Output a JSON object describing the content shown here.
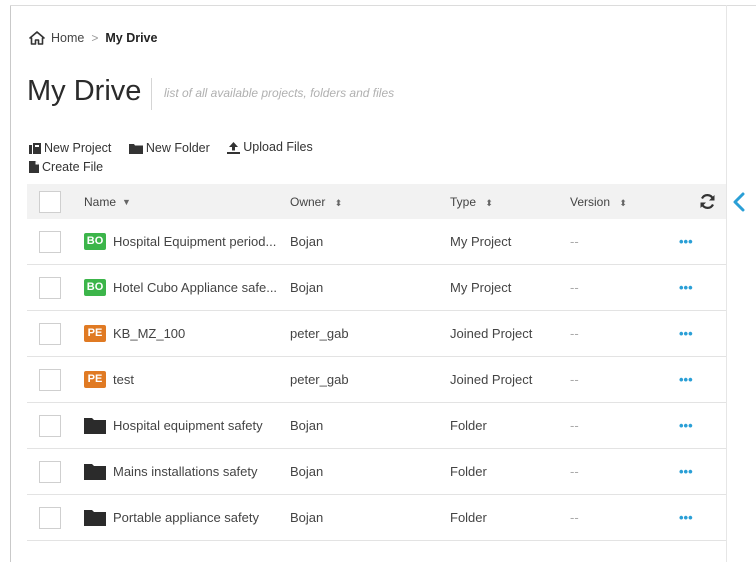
{
  "breadcrumb": {
    "home": "Home",
    "separator": ">",
    "current": "My Drive"
  },
  "header": {
    "title": "My Drive",
    "subtitle": "list of all available projects, folders and files"
  },
  "toolbar": {
    "new_project": "New Project",
    "new_folder": "New Folder",
    "upload_files": "Upload Files",
    "create_file": "Create File"
  },
  "table": {
    "columns": {
      "name": "Name",
      "owner": "Owner",
      "type": "Type",
      "version": "Version"
    },
    "rows": [
      {
        "badge": "BO",
        "name": "Hospital Equipment period...",
        "owner": "Bojan",
        "type": "My Project",
        "version": "--",
        "actions": "•••"
      },
      {
        "badge": "BO",
        "name": "Hotel Cubo Appliance safe...",
        "owner": "Bojan",
        "type": "My Project",
        "version": "--",
        "actions": "•••"
      },
      {
        "badge": "PE",
        "name": "KB_MZ_100",
        "owner": "peter_gab",
        "type": "Joined Project",
        "version": "--",
        "actions": "•••"
      },
      {
        "badge": "PE",
        "name": "test",
        "owner": "peter_gab",
        "type": "Joined Project",
        "version": "--",
        "actions": "•••"
      },
      {
        "badge": "",
        "name": "Hospital equipment safety",
        "owner": "Bojan",
        "type": "Folder",
        "version": "--",
        "actions": "•••"
      },
      {
        "badge": "",
        "name": "Mains installations safety",
        "owner": "Bojan",
        "type": "Folder",
        "version": "--",
        "actions": "•••"
      },
      {
        "badge": "",
        "name": "Portable appliance safety",
        "owner": "Bojan",
        "type": "Folder",
        "version": "--",
        "actions": "•••"
      }
    ]
  },
  "colors": {
    "bo_badge": "#3cb54a",
    "pe_badge": "#e07a23",
    "accent": "#2a9fd6",
    "folder": "#2b2b2b"
  }
}
